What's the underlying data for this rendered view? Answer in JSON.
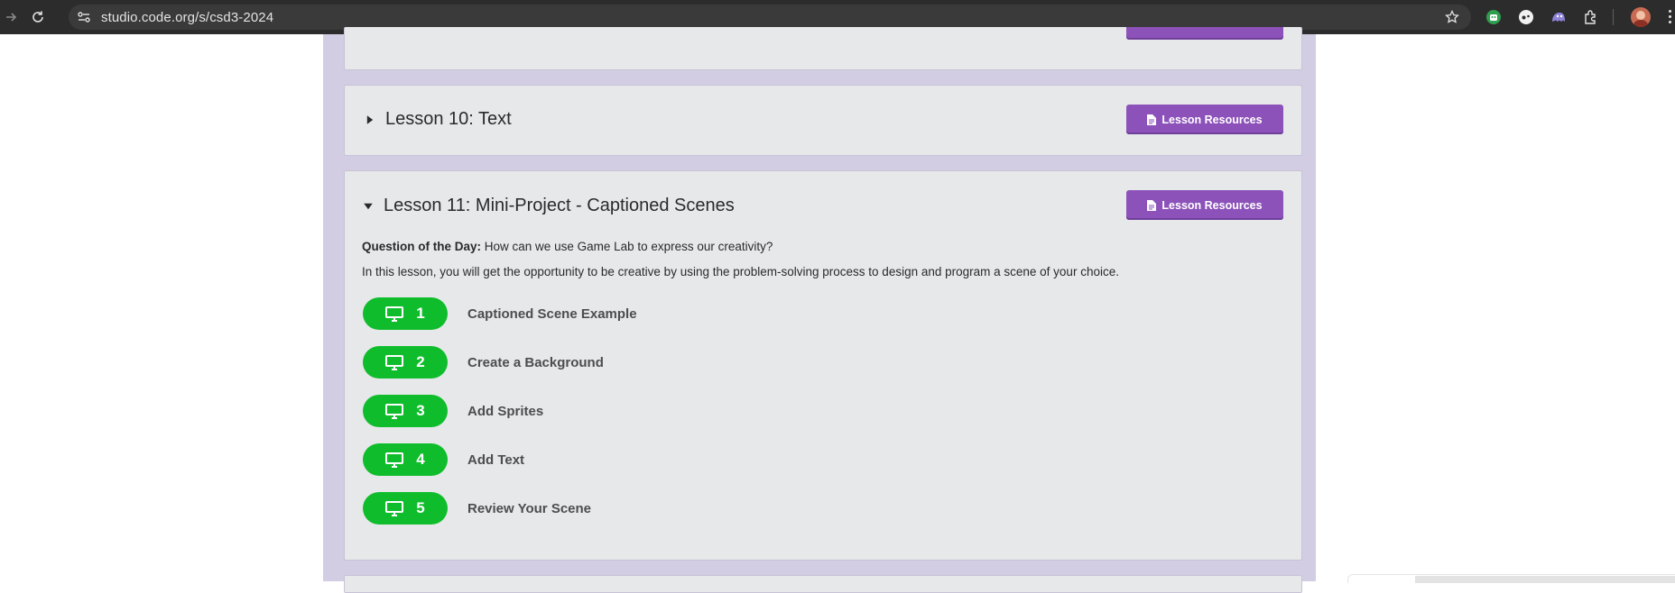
{
  "browser": {
    "url": "studio.code.org/s/csd3-2024",
    "icons": {
      "forward": "forward-arrow-icon",
      "reload": "reload-icon",
      "site_info": "site-info-icon",
      "bookmark": "bookmark-star-icon",
      "extensions": [
        "robot-extension-icon",
        "gamepad-extension-icon",
        "ghost-extension-icon",
        "puzzle-extensions-icon"
      ],
      "profile": "profile-avatar",
      "menu": "kebab-menu-icon"
    }
  },
  "lessons": [
    {
      "title": "Lesson 10: Text",
      "expanded": false,
      "resources_label": "Lesson Resources"
    },
    {
      "title": "Lesson 11: Mini-Project - Captioned Scenes",
      "expanded": true,
      "resources_label": "Lesson Resources",
      "question_label": "Question of the Day:",
      "question": "How can we use Game Lab to express our creativity?",
      "description": "In this lesson, you will get the opportunity to be creative by using the problem-solving process to design and program a scene of your choice.",
      "levels": [
        {
          "number": "1",
          "label": "Captioned Scene Example",
          "icon": "computer-monitor-icon"
        },
        {
          "number": "2",
          "label": "Create a Background",
          "icon": "computer-monitor-icon"
        },
        {
          "number": "3",
          "label": "Add Sprites",
          "icon": "computer-monitor-icon"
        },
        {
          "number": "4",
          "label": "Add Text",
          "icon": "computer-monitor-icon"
        },
        {
          "number": "5",
          "label": "Review Your Scene",
          "icon": "computer-monitor-icon"
        }
      ]
    }
  ],
  "colors": {
    "resources_button": "#8c52ba",
    "level_bubble": "#0fbd2c",
    "column_background": "#d3cde3",
    "card_background": "#e7e8ea"
  }
}
